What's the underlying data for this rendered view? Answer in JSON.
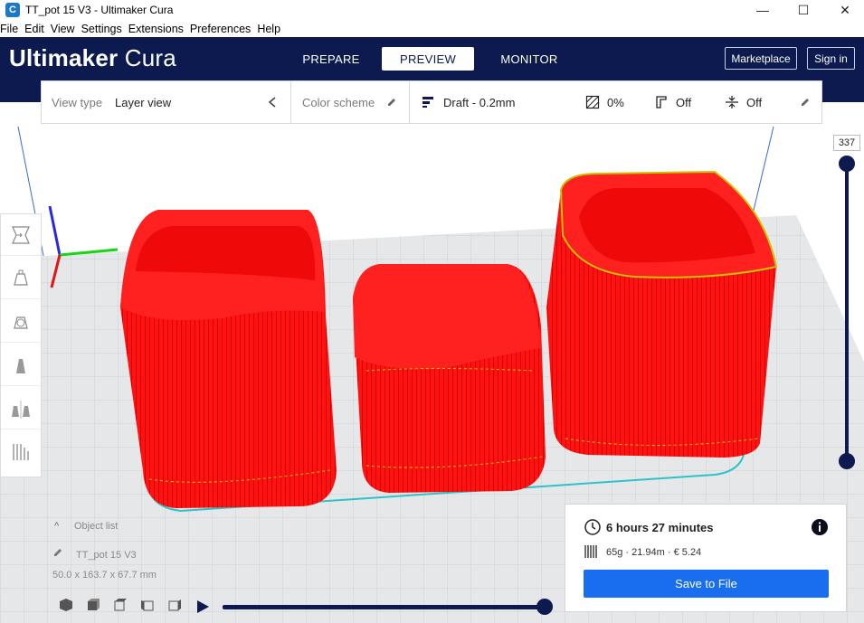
{
  "window": {
    "title": "TT_pot 15 V3 - Ultimaker Cura",
    "app_icon": "C",
    "minimize_glyph": "—",
    "maximize_glyph": "☐",
    "close_glyph": "✕"
  },
  "menu": [
    "File",
    "Edit",
    "View",
    "Settings",
    "Extensions",
    "Preferences",
    "Help"
  ],
  "header": {
    "logo_bold": "Ultimaker",
    "logo_light": "Cura",
    "tabs": [
      {
        "label": "PREPARE",
        "active": false
      },
      {
        "label": "PREVIEW",
        "active": true
      },
      {
        "label": "MONITOR",
        "active": false
      }
    ],
    "marketplace_label": "Marketplace",
    "signin_label": "Sign in"
  },
  "viewbar": {
    "view_type_label": "View type",
    "view_type_value": "Layer view",
    "color_scheme_label": "Color scheme",
    "profile": "Draft - 0.2mm",
    "infill": "0%",
    "support": "Off",
    "adhesion": "Off"
  },
  "layer_slider": {
    "current_layer": "337"
  },
  "object_list": {
    "header": "Object list",
    "object_name": "TT_pot 15 V3",
    "dimensions": "50.0 x 163.7 x 67.7 mm"
  },
  "print_info": {
    "time": "6 hours 27 minutes",
    "material": "65g · 21.94m · € 5.24",
    "save_label": "Save to File"
  },
  "colors": {
    "header_bg": "#0c1a4f",
    "accent_blue": "#196ef0",
    "print_red": "#ff1a1a",
    "buildplate": "#e3e4e6"
  },
  "icons": [
    "cura-app-icon",
    "pencil-icon",
    "profile-icon",
    "infill-icon",
    "support-icon",
    "adhesion-icon",
    "chevron-left-icon",
    "clock-icon",
    "info-icon",
    "spool-icon",
    "play-icon"
  ]
}
